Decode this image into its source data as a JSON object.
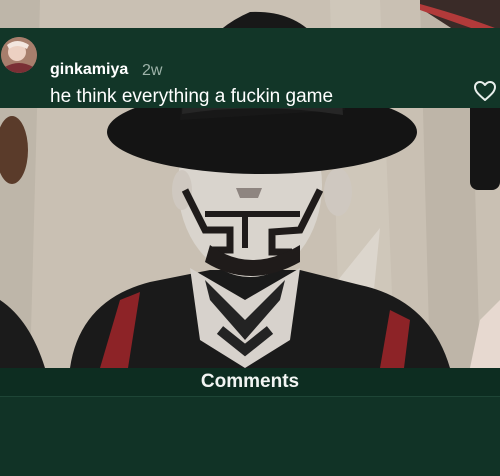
{
  "sheet": {
    "title": "Comments"
  },
  "comment": {
    "username": "ginkamiya",
    "time_ago": "2w",
    "text": "he think everything a fuckin game",
    "like_icon": "heart-outline-icon"
  },
  "colors": {
    "sheet_background": "#113326",
    "header_background": "#0d2d21",
    "text_primary": "#ffffff",
    "text_secondary": "#9db3a9"
  }
}
